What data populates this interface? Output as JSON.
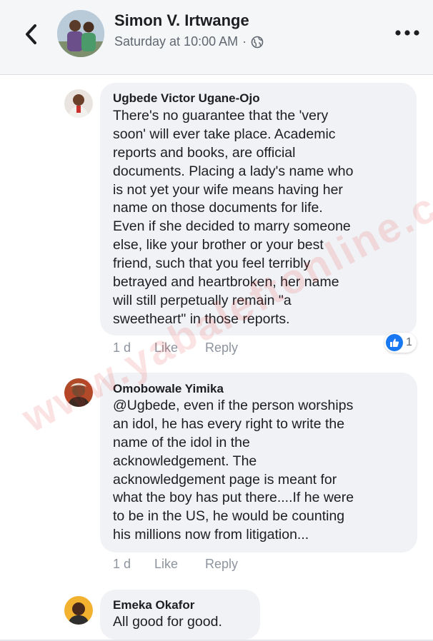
{
  "header": {
    "name": "Simon V. Irtwange",
    "timestamp": "Saturday at 10:00 AM",
    "separator": "·",
    "privacy_icon": "globe-icon",
    "back_icon": "chevron-left-icon",
    "more_icon": "more-horizontal-icon"
  },
  "comments": [
    {
      "author": "Ugbede Victor Ugane-Ojo",
      "lines": [
        "There's no guarantee that the 'very",
        "soon' will ever take place. Academic",
        "reports and books, are official",
        "documents. Placing a lady's name who",
        "is not yet your wife means having her",
        "name on those documents for life.",
        "Even if she decided to marry someone",
        "else, like your brother or your best",
        "friend, such that you feel terribly",
        "betrayed and heartbroken, her name",
        "will still perpetually remain \"a",
        "sweetheart\" in those reports."
      ],
      "time": "1 d",
      "like_label": "Like",
      "reply_label": "Reply",
      "reaction_icon": "thumbs-up-icon",
      "reaction_count": "1"
    },
    {
      "author": "Omobowale Yimika",
      "lines": [
        "@Ugbede, even if the person worships",
        "an idol, he has every right to write the",
        "name of the idol in the",
        "acknowledgement. The",
        "acknowledgement page is meant for",
        "what the boy has put there....If he were",
        "to be in the US, he would be counting",
        "his millions now from litigation..."
      ],
      "time": "1 d",
      "like_label": "Like",
      "reply_label": "Reply"
    },
    {
      "author": "Emeka Okafor",
      "lines": [
        "All good for good."
      ]
    }
  ],
  "watermark": "www.yabaleftonline.com",
  "colors": {
    "header_bg": "#f5f6f7",
    "bubble_bg": "#f0f2f5",
    "like_blue": "#1877f2",
    "meta_gray": "#8d949e"
  }
}
